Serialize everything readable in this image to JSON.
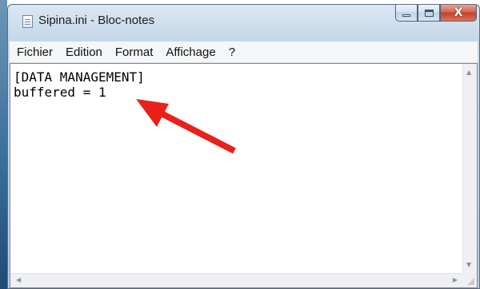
{
  "window": {
    "title": "Sipina.ini - Bloc-notes",
    "close_glyph": "X"
  },
  "menu": {
    "items": [
      "Fichier",
      "Edition",
      "Format",
      "Affichage",
      "?"
    ]
  },
  "editor": {
    "lines": [
      "[DATA MANAGEMENT]",
      "buffered = 1"
    ]
  },
  "annotation": {
    "color": "#e8211b",
    "icon": "red-arrow-icon"
  },
  "colors": {
    "close_button": "#c4412a",
    "menubar_bg": "#f5f6f7"
  }
}
